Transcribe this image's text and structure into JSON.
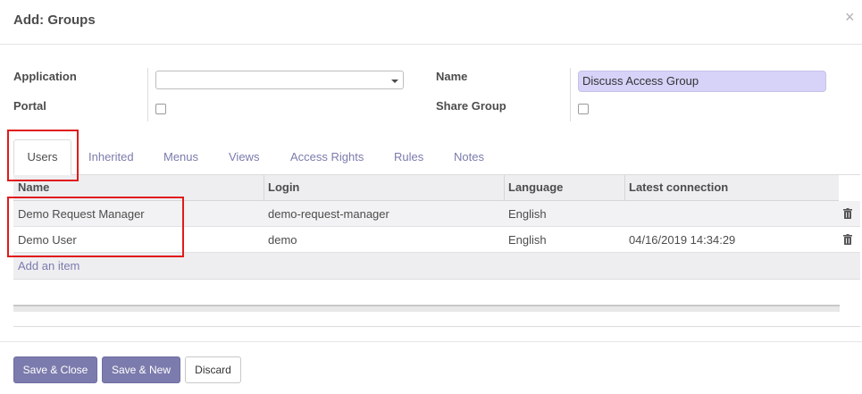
{
  "dialog": {
    "title": "Add: Groups",
    "close_glyph": "×"
  },
  "form": {
    "application_label": "Application",
    "application_value": "",
    "portal_label": "Portal",
    "name_label": "Name",
    "name_value": "Discuss Access Group",
    "share_group_label": "Share Group"
  },
  "tabs": [
    {
      "label": "Users",
      "active": true
    },
    {
      "label": "Inherited"
    },
    {
      "label": "Menus"
    },
    {
      "label": "Views"
    },
    {
      "label": "Access Rights"
    },
    {
      "label": "Rules"
    },
    {
      "label": "Notes"
    }
  ],
  "table": {
    "columns": [
      "Name",
      "Login",
      "Language",
      "Latest connection"
    ],
    "rows": [
      {
        "name": "Demo Request Manager",
        "login": "demo-request-manager",
        "language": "English",
        "latest_connection": ""
      },
      {
        "name": "Demo User",
        "login": "demo",
        "language": "English",
        "latest_connection": "04/16/2019 14:34:29"
      }
    ],
    "add_item": "Add an item"
  },
  "footer": {
    "save_close": "Save & Close",
    "save_new": "Save & New",
    "discard": "Discard"
  },
  "colors": {
    "accent": "#7c7bad",
    "highlight_box": "#e01b1b",
    "name_field_bg": "#d6d2f8"
  },
  "icons": {
    "close": "close-icon",
    "dropdown": "caret-down-icon",
    "delete": "trash-icon"
  }
}
